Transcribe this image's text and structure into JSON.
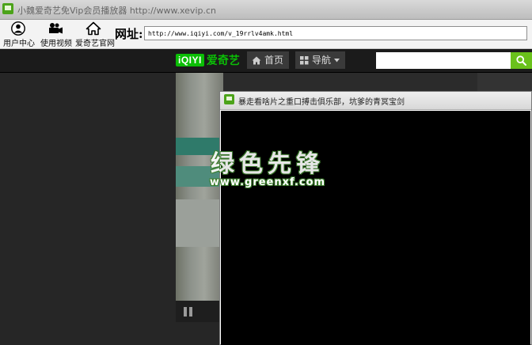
{
  "window": {
    "title": "小魏爱奇艺免Vip会员播放器 http://www.xevip.cn"
  },
  "toolbar": {
    "user_center": "用户中心",
    "use_video": "使用视频",
    "iqiyi_site": "爱奇艺官网",
    "address_label": "网址:",
    "address_value": "http://www.iqiyi.com/v_19rrlv4amk.html"
  },
  "nav": {
    "logo_mark": "iQIYI",
    "logo_name": "爱奇艺",
    "home": "首页",
    "guide": "导航",
    "search_value": ""
  },
  "popup": {
    "title": "暴走看啥片之重口搏击俱乐部，坑爹的青冥宝剑"
  },
  "watermark": {
    "main": "绿色先锋",
    "sub": "www.greenxf.com"
  },
  "colors": {
    "iqiyi_green": "#0bbe06",
    "search_green": "#6ac11b",
    "app_icon_green": "#4ca31a"
  }
}
